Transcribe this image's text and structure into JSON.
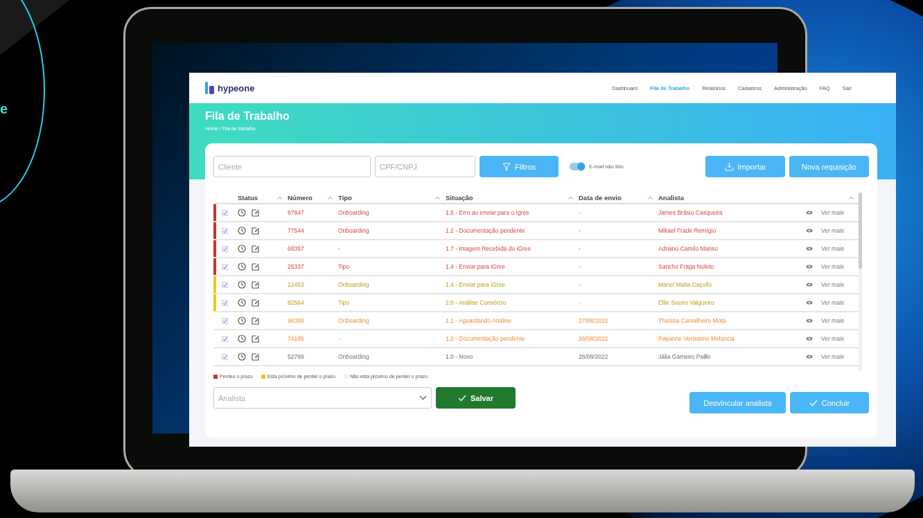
{
  "side_text": "e",
  "app": {
    "nav": {
      "items": [
        {
          "label": "Dashboard",
          "selected": false
        },
        {
          "label": "Fila de Trabalho",
          "selected": true
        },
        {
          "label": "Relatórios",
          "selected": false
        },
        {
          "label": "Cadastros",
          "selected": false
        },
        {
          "label": "Administração",
          "selected": false
        },
        {
          "label": "FAQ",
          "selected": false
        },
        {
          "label": "Sair",
          "selected": false
        }
      ]
    },
    "logo": {
      "name": "hypeone"
    },
    "page_title": "Fila de Trabalho",
    "breadcrumb": "Home / Fila de trabalho",
    "filters": {
      "cliente": {
        "placeholder": "Cliente"
      },
      "cpf": {
        "placeholder": "CPF/CNPJ"
      },
      "filter_button": "Filtros",
      "toggle": {
        "label": "E-mail não lido",
        "on": true
      },
      "import_button": "Importar",
      "new_button": "Nova requisição"
    },
    "table": {
      "columns": [
        "Status",
        "Número",
        "Tipo",
        "Situação",
        "Data de envio",
        "Analista"
      ],
      "rows": [
        {
          "kind": "missed",
          "checked": true,
          "numero": "87847",
          "tipo": "Onboarding",
          "situacao": "1.5 - Erro ao enviar para o Igree",
          "data": "-",
          "analista": "James Brásio Casqueira",
          "action": "Ver mais"
        },
        {
          "kind": "missed",
          "checked": true,
          "numero": "77544",
          "tipo": "Onboarding",
          "situacao": "1.2 - Documentação pendente",
          "data": "-",
          "analista": "Mikael Frade Remígio",
          "action": "Ver mais"
        },
        {
          "kind": "missed",
          "checked": true,
          "numero": "68357",
          "tipo": "-",
          "situacao": "1.7 - Imagem Recebida do iGree",
          "data": "-",
          "analista": "Adriano Camilo Manso",
          "action": "Ver mais"
        },
        {
          "kind": "missed",
          "checked": true,
          "numero": "25337",
          "tipo": "Tipo",
          "situacao": "1.4 - Enviar para iGree",
          "data": "-",
          "analista": "Sancho Fraga Noleto",
          "action": "Ver mais"
        },
        {
          "kind": "near",
          "checked": true,
          "numero": "12453",
          "tipo": "Onboarding",
          "situacao": "1.4 - Enviar para iGree",
          "data": "-",
          "analista": "Manel Malta Caçollo",
          "action": "Ver mais"
        },
        {
          "kind": "near",
          "checked": true,
          "numero": "82564",
          "tipo": "Tipo",
          "situacao": "2.0 - Análise Consórcio",
          "data": "-",
          "analista": "Ellie Soeiro Valgueiro",
          "action": "Ver mais"
        },
        {
          "kind": "pending",
          "checked": true,
          "numero": "96385",
          "tipo": "Onboarding",
          "situacao": "1.1 - Aguardando Análise",
          "data": "27/08/2022",
          "analista": "Thaíssa Carvalheiro Mota",
          "action": "Ver mais"
        },
        {
          "kind": "pending",
          "checked": true,
          "numero": "74185",
          "tipo": "-",
          "situacao": "1.2 - Documentação pendente",
          "data": "26/08/2022",
          "analista": "Rayanne Veríssimo Melancia",
          "action": "Ver mais"
        },
        {
          "kind": "normal",
          "checked": true,
          "numero": "52789",
          "tipo": "Onboarding",
          "situacao": "1.0 - Novo",
          "data": "26/08/2022",
          "analista": "Jália Gameiro Paiłło",
          "action": "Ver mais"
        }
      ]
    },
    "legend": [
      {
        "label": "Perdeu o prazo",
        "color": "#d32f2f"
      },
      {
        "label": "Esta próximo de perder o prazo",
        "color": "#f5c518"
      },
      {
        "label": "Não esta próximo de perder o prazo",
        "color": "#eeeeee"
      }
    ],
    "analyst_select": {
      "placeholder": "Analista"
    },
    "save_button": "Salvar",
    "unlink_button": "Desvincular analista",
    "finish_button": "Concluir"
  }
}
